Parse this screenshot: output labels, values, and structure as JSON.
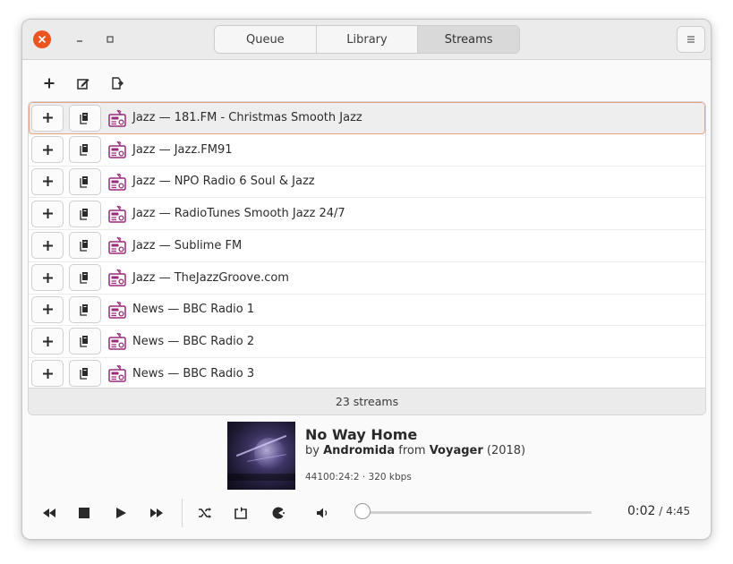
{
  "header": {
    "tabs": [
      {
        "label": "Queue",
        "active": false
      },
      {
        "label": "Library",
        "active": false
      },
      {
        "label": "Streams",
        "active": true
      }
    ],
    "window_controls": [
      "close-icon",
      "minimize-icon",
      "maximize-icon"
    ],
    "menu_icon": "hamburger-icon"
  },
  "toolbar": {
    "icons": [
      "plus-icon",
      "edit-icon",
      "export-icon"
    ]
  },
  "streams": [
    {
      "label": "Jazz — 181.FM - Christmas Smooth Jazz",
      "selected": true
    },
    {
      "label": "Jazz — Jazz.FM91",
      "selected": false
    },
    {
      "label": "Jazz — NPO Radio 6 Soul & Jazz",
      "selected": false
    },
    {
      "label": "Jazz — RadioTunes Smooth Jazz 24/7",
      "selected": false
    },
    {
      "label": "Jazz — Sublime FM",
      "selected": false
    },
    {
      "label": "Jazz — TheJazzGroove.com",
      "selected": false
    },
    {
      "label": "News — BBC Radio 1",
      "selected": false
    },
    {
      "label": "News — BBC Radio 2",
      "selected": false
    },
    {
      "label": "News — BBC Radio 3",
      "selected": false
    }
  ],
  "list_footer": "23 streams",
  "now_playing": {
    "title": "No Way Home",
    "by_prefix": "by",
    "artist": "Andromida",
    "from_prefix": "from",
    "album": "Voyager",
    "year": "(2018)",
    "tech": "44100:24:2 · 320 kbps"
  },
  "controls": {
    "icons": [
      "rewind-icon",
      "stop-icon",
      "play-icon",
      "fast-forward-icon",
      "shuffle-icon",
      "repeat-icon",
      "consume-icon",
      "volume-icon"
    ],
    "position": "0:02",
    "separator": " / ",
    "duration": "4:45",
    "progress_fraction": 0.007
  },
  "colors": {
    "accent": "#e95420",
    "selected_outline": "#e9a27f",
    "radio_icon": "#9c2a7a"
  }
}
